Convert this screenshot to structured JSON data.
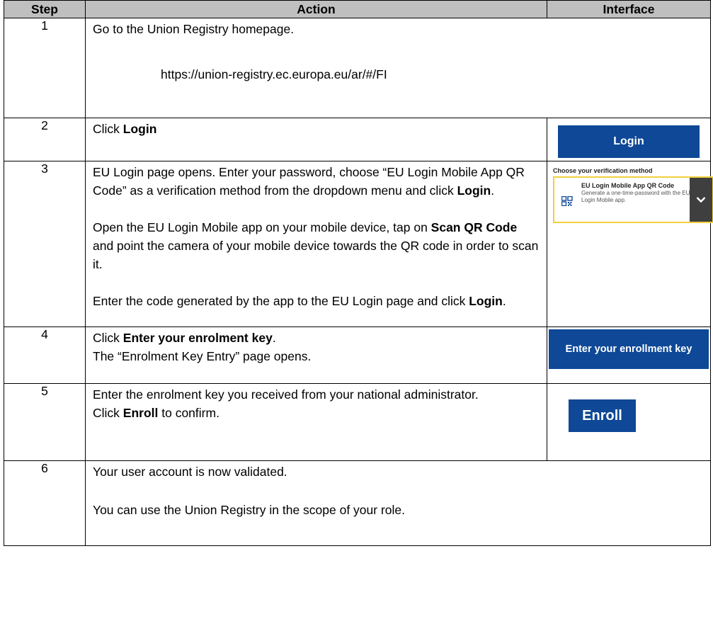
{
  "headers": {
    "step": "Step",
    "action": "Action",
    "interface": "Interface"
  },
  "rows": [
    {
      "step": "1",
      "line1": "Go to the Union Registry homepage.",
      "url": "https://union-registry.ec.europa.eu/ar/#/FI"
    },
    {
      "step": "2",
      "pre": "Click ",
      "bold": "Login",
      "ui_button": "Login"
    },
    {
      "step": "3",
      "p1_pre": "EU Login page opens. Enter your password, choose “EU Login Mobile App QR Code” as a verification method from the dropdown menu and click ",
      "p1_bold": "Login",
      "p1_post": ".",
      "p2_pre": "Open the EU Login Mobile app on your mobile device, tap on ",
      "p2_bold": "Scan QR Code",
      "p2_post": " and point the camera of your mobile device towards the QR code in order to scan it.",
      "p3_pre": "Enter the code generated by the app to the EU Login page and click ",
      "p3_bold": "Login",
      "p3_post": ".",
      "ui": {
        "title": "Choose your verification method",
        "option_title": "EU Login Mobile App QR Code",
        "option_desc": "Generate a one-time-password with the EU Login Mobile app."
      }
    },
    {
      "step": "4",
      "pre": "Click ",
      "bold": "Enter your enrolment key",
      "post": ".",
      "line2": "The “Enrolment Key Entry” page opens.",
      "ui_button": "Enter your enrollment key"
    },
    {
      "step": "5",
      "line1": "Enter the enrolment key you received from your national administrator.",
      "pre": "Click ",
      "bold": "Enroll",
      "post": " to confirm.",
      "ui_button": "Enroll"
    },
    {
      "step": "6",
      "line1": "Your user account is now validated.",
      "line2": "You can use the Union Registry in the scope of your role."
    }
  ],
  "colors": {
    "header_bg": "#bfbfbf",
    "button_blue": "#0e4896",
    "select_border": "#f2d03b"
  }
}
